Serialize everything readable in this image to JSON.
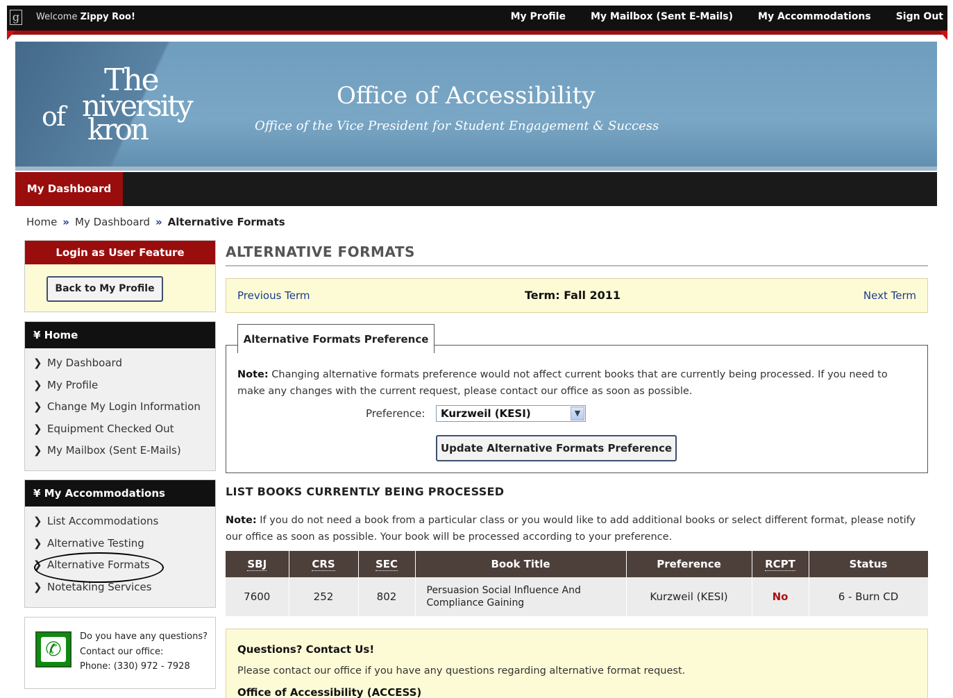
{
  "topbar": {
    "logo_glyph": "g",
    "welcome_prefix": "Welcome",
    "user_name": "Zippy Roo!",
    "nav": [
      "My Profile",
      "My Mailbox (Sent E-Mails)",
      "My Accommodations",
      "Sign Out"
    ]
  },
  "banner": {
    "logo_lines": [
      "The",
      "niversity",
      "of",
      "kron"
    ],
    "title": "Office of Accessibility",
    "subtitle": "Office of the Vice President for Student Engagement & Success"
  },
  "navbar": {
    "active_tab": "My Dashboard"
  },
  "breadcrumb": {
    "items": [
      "Home",
      "My Dashboard"
    ],
    "separator": "»",
    "current": "Alternative Formats"
  },
  "sidebar": {
    "login_panel": {
      "title": "Login as User Feature",
      "button": "Back to My Profile"
    },
    "home_panel": {
      "title": "Home",
      "items": [
        "My Dashboard",
        "My Profile",
        "Change My Login Information",
        "Equipment Checked Out",
        "My Mailbox (Sent E-Mails)"
      ]
    },
    "accommodations_panel": {
      "title": "My Accommodations",
      "items": [
        "List Accommodations",
        "Alternative Testing",
        "Alternative Formats",
        "Notetaking Services"
      ]
    },
    "contact_panel": {
      "line1": "Do you have any questions?",
      "line2": "Contact our office:",
      "line3": "Phone: (330) 972 - 7928"
    },
    "chevron": "❯",
    "collapse_glyph": "¥"
  },
  "main": {
    "title": "ALTERNATIVE FORMATS",
    "term_bar": {
      "previous": "Previous Term",
      "term": "Term: Fall 2011",
      "next": "Next Term"
    },
    "preference": {
      "tab_label": "Alternative Formats Preference",
      "note_label": "Note:",
      "note_text": " Changing alternative formats preference would not affect current books that are currently being processed. If you need to make any changes with the current request, please contact our office as soon as possible.",
      "field_label": "Preference:",
      "selected_value": "Kurzweil (KESI)",
      "update_button": "Update Alternative Formats Preference"
    },
    "books": {
      "title": "LIST BOOKS CURRENTLY BEING PROCESSED",
      "note_label": "Note:",
      "note_text": " If you do not need a book from a particular class or you would like to add additional books or select different format, please notify our office as soon as possible. Your book will be processed according to your preference.",
      "columns": [
        "SBJ",
        "CRS",
        "SEC",
        "Book Title",
        "Preference",
        "RCPT",
        "Status"
      ],
      "rows": [
        {
          "sbj": "7600",
          "crs": "252",
          "sec": "802",
          "title": "Persuasion Social Influence And Compliance Gaining",
          "preference": "Kurzweil (KESI)",
          "rcpt": "No",
          "status": "6 - Burn CD"
        }
      ]
    },
    "contact": {
      "heading": "Questions? Contact Us!",
      "text": "Please contact our office if you have any questions regarding alternative format request.",
      "office": "Office of Accessibility (ACCESS)"
    }
  },
  "colors": {
    "accent_red": "#9a0d0d",
    "header_dark": "#111111",
    "link_blue": "#1b3a8a",
    "table_header": "#4d3f3a",
    "highlight_yellow": "#fdfbd6"
  }
}
